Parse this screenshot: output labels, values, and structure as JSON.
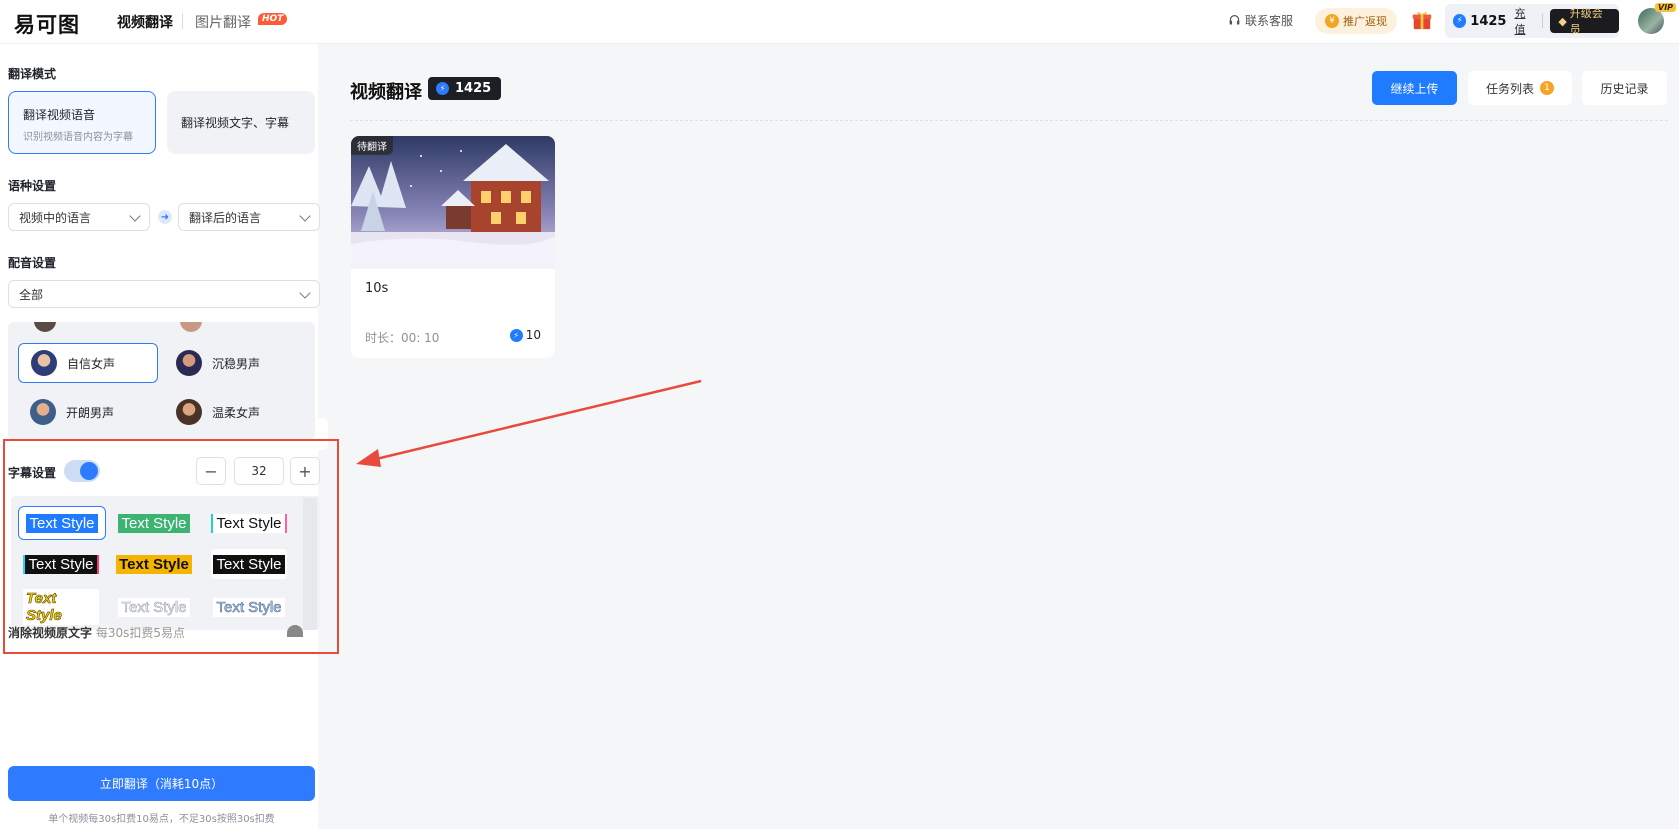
{
  "header": {
    "logo": "易可图",
    "nav": [
      {
        "label": "视频翻译",
        "active": true
      },
      {
        "label": "图片翻译",
        "badge": "HOT"
      }
    ],
    "support": "联系客服",
    "promo": "推广返现",
    "points": "1425",
    "recharge": "充值",
    "upgrade": "升级会员",
    "vip_tag": "VIP"
  },
  "sidebar": {
    "mode_title": "翻译模式",
    "modes": [
      {
        "title": "翻译视频语音",
        "desc": "识别视频语音内容为字幕",
        "active": true
      },
      {
        "title": "翻译视频文字、字幕",
        "desc": "",
        "active": false
      }
    ],
    "lang_title": "语种设置",
    "source_lang": "视频中的语言",
    "target_lang": "翻译后的语言",
    "dub_title": "配音设置",
    "dub_filter": "全部",
    "voices": [
      {
        "name": "自信女声",
        "active": true
      },
      {
        "name": "沉稳男声",
        "active": false
      },
      {
        "name": "开朗男声",
        "active": false
      },
      {
        "name": "温柔女声",
        "active": false
      }
    ],
    "subtitle_title": "字幕设置",
    "subtitle_enabled": true,
    "font_size": "32",
    "minus": "−",
    "plus": "+",
    "text_style_label": "Text Style",
    "hidden_row_title": "消除视频原文字",
    "hidden_row_note": "每30s扣费5易点",
    "translate_button": "立即翻译（消耗10点）",
    "footnote": "单个视频每30s扣费10易点，不足30s按照30s扣费"
  },
  "main": {
    "title": "视频翻译",
    "points": "1425",
    "continue_upload": "继续上传",
    "task_list": "任务列表",
    "task_count": "1",
    "history": "历史记录",
    "videos": [
      {
        "status": "待翻译",
        "name": "10s",
        "duration": "时长：00: 10",
        "cost": "10"
      }
    ]
  },
  "colors": {
    "accent": "#2f7bff",
    "annotation": "#e84a3b"
  }
}
